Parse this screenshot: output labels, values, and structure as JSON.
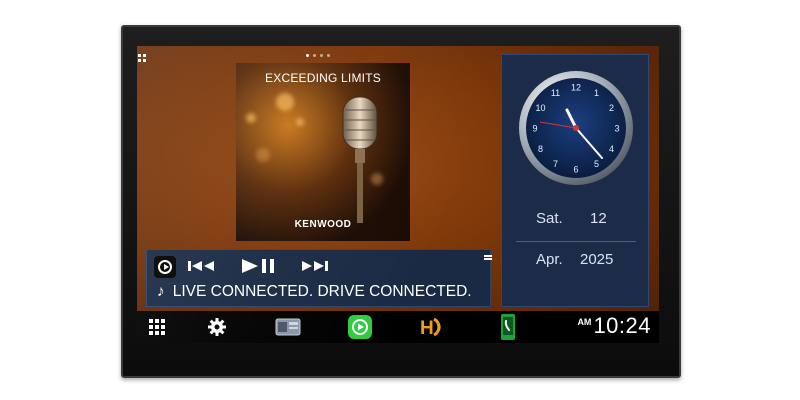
{
  "album": {
    "title": "EXCEEDING LIMITS",
    "brand": "KENWOOD"
  },
  "media": {
    "ticker_text": "LIVE CONNECTED. DRIVE CONNECTED.",
    "note_glyph": "♪"
  },
  "clock": {
    "day": "Sat.",
    "date": "12",
    "month": "Apr.",
    "year": "2025",
    "dial_numbers": [
      "12",
      "1",
      "2",
      "3",
      "4",
      "5",
      "6",
      "7",
      "8",
      "9",
      "10",
      "11"
    ]
  },
  "statusbar": {
    "ampm": "AM",
    "time": "10:24"
  },
  "dock": {
    "items": [
      "apps-grid-icon",
      "settings-icon",
      "radio-icon",
      "carplay-icon",
      "hd-radio-icon",
      "phone-icon"
    ]
  },
  "colors": {
    "panel_bg": "#1a2a44",
    "carplay_green": "#2ecc40",
    "hd_orange": "#f39c12"
  }
}
